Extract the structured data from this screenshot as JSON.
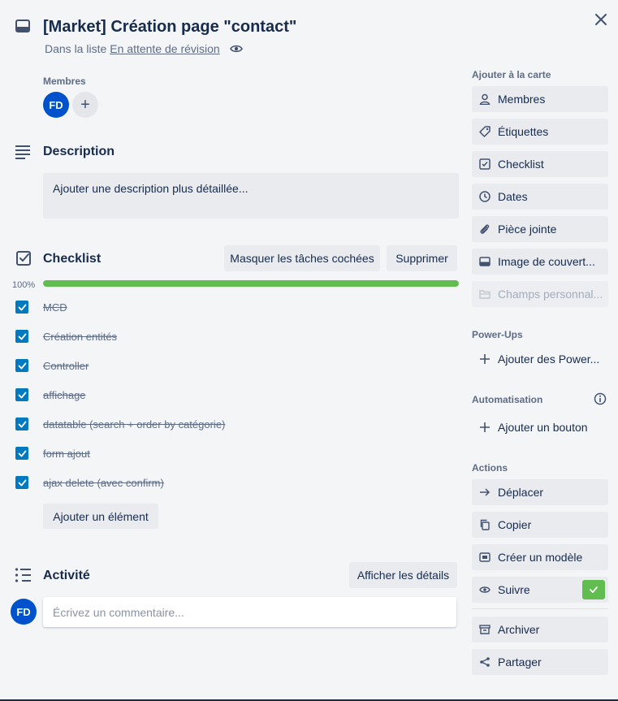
{
  "card": {
    "title": "[Market] Création page \"contact\"",
    "in_list_prefix": "Dans la liste",
    "list_name": "En attente de révision"
  },
  "members": {
    "label": "Membres",
    "avatar_initials": "FD",
    "add_symbol": "+"
  },
  "description": {
    "title": "Description",
    "placeholder": "Ajouter une description plus détaillée..."
  },
  "checklist": {
    "title": "Checklist",
    "hide_checked_label": "Masquer les tâches cochées",
    "delete_label": "Supprimer",
    "progress_text": "100%",
    "progress_fraction": 1.0,
    "items": [
      {
        "label": "MCD",
        "checked": true
      },
      {
        "label": "Création entités",
        "checked": true
      },
      {
        "label": "Controller",
        "checked": true
      },
      {
        "label": "affichage",
        "checked": true
      },
      {
        "label": "datatable (search + order by catégorie)",
        "checked": true
      },
      {
        "label": "form ajout",
        "checked": true
      },
      {
        "label": "ajax delete (avec confirm)",
        "checked": true
      }
    ],
    "add_item_label": "Ajouter un élément"
  },
  "activity": {
    "title": "Activité",
    "show_details_label": "Afficher les détails",
    "comment_placeholder": "Écrivez un commentaire..."
  },
  "sidebar": {
    "add_to_card_label": "Ajouter à la carte",
    "add_to_card": [
      {
        "label": "Membres",
        "icon": "person-icon"
      },
      {
        "label": "Étiquettes",
        "icon": "tag-icon"
      },
      {
        "label": "Checklist",
        "icon": "checkbox-icon"
      },
      {
        "label": "Dates",
        "icon": "clock-icon"
      },
      {
        "label": "Pièce jointe",
        "icon": "paperclip-icon"
      },
      {
        "label": "Image de couvert...",
        "icon": "card-cover-icon"
      },
      {
        "label": "Champs personnal...",
        "icon": "folder-icon"
      }
    ],
    "powerups_label": "Power-Ups",
    "add_powerups": "Ajouter des Power...",
    "automation_label": "Automatisation",
    "add_button": "Ajouter un bouton",
    "actions_label": "Actions",
    "actions": [
      {
        "label": "Déplacer",
        "icon": "arrow-right-icon"
      },
      {
        "label": "Copier",
        "icon": "copy-icon"
      },
      {
        "label": "Créer un modèle",
        "icon": "template-icon"
      },
      {
        "label": "Suivre",
        "icon": "eye-icon"
      }
    ],
    "archive": "Archiver",
    "share": "Partager"
  },
  "colors": {
    "progress": "#61bd4f",
    "checkbox": "#0079bf",
    "avatar": "#0052cc",
    "follow_check": "#61bd4f"
  }
}
